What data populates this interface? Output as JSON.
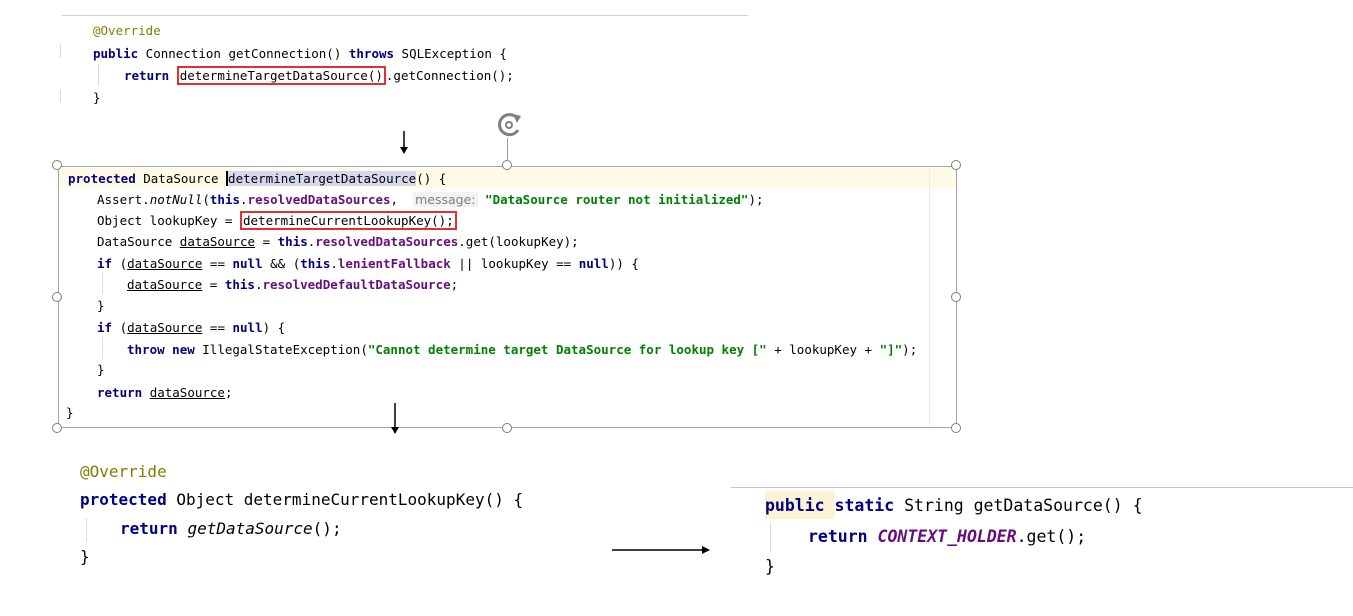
{
  "snippet1": {
    "line1": "@Override",
    "line2": {
      "kw_public": "public",
      "type": " Connection getConnection() ",
      "kw_throws": "throws",
      "exc": " SQLException {"
    },
    "line3": {
      "kw_return": "return",
      "boxed": "determineTargetDataSource()",
      "rest": ".getConnection();"
    },
    "line4": "}"
  },
  "snippet2": {
    "line1": {
      "kw": "protected",
      "type": " DataSource ",
      "method": "determineTargetDataSource",
      "rest": "() {"
    },
    "line2": {
      "pre": "Assert.",
      "call": "notNull",
      "paren": "(",
      "kw_this": "this",
      "dot": ".",
      "field": "resolvedDataSources",
      "comma": ",  ",
      "hint": "message:",
      "str": "\"DataSource router not initialized\"",
      "end": ");"
    },
    "line3": {
      "pre": "Object lookupKey = ",
      "boxed": "determineCurrentLookupKey();"
    },
    "line4": {
      "pre": "DataSource ",
      "var": "dataSource",
      "mid": " = ",
      "kw_this": "this",
      "dot": ".",
      "field": "resolvedDataSources",
      "rest": ".get(lookupKey);"
    },
    "line5": {
      "kw_if": "if",
      "p1": " (",
      "var": "dataSource",
      "p2": " == ",
      "kw_null": "null",
      "p3": " && (",
      "kw_this": "this",
      "dot": ".",
      "field": "lenientFallback",
      "p4": " || lookupKey == ",
      "kw_null2": "null",
      "p5": ")) {"
    },
    "line6": {
      "var": "dataSource",
      "mid": " = ",
      "kw_this": "this",
      "dot": ".",
      "field": "resolvedDefaultDataSource",
      "end": ";"
    },
    "line7": "}",
    "line8": {
      "kw_if": "if",
      "p1": " (",
      "var": "dataSource",
      "p2": " == ",
      "kw_null": "null",
      "p3": ") {"
    },
    "line9": {
      "kw_throw": "throw",
      "sp": " ",
      "kw_new": "new",
      "pre": " IllegalStateException(",
      "str1": "\"Cannot determine target DataSource for lookup key [\"",
      "mid": " + lookupKey + ",
      "str2": "\"]\"",
      "end": ");"
    },
    "line10": "}",
    "line11": {
      "kw_return": "return",
      "sp": " ",
      "var": "dataSource",
      "end": ";"
    },
    "line12": "}"
  },
  "snippet3": {
    "line1": "@Override",
    "line2": {
      "kw": "protected",
      "rest": " Object determineCurrentLookupKey() {"
    },
    "line3": {
      "kw_return": "return",
      "sp": " ",
      "call": "getDataSource",
      "end": "();"
    },
    "line4": "}"
  },
  "snippet4": {
    "line1": {
      "kw_public": "public",
      "sp": " ",
      "kw_static": "static",
      "rest": " String getDataSource() {"
    },
    "line2": {
      "kw_return": "return",
      "sp": " ",
      "field": "CONTEXT_HOLDER",
      "rest": ".get();"
    },
    "line3": "}"
  }
}
